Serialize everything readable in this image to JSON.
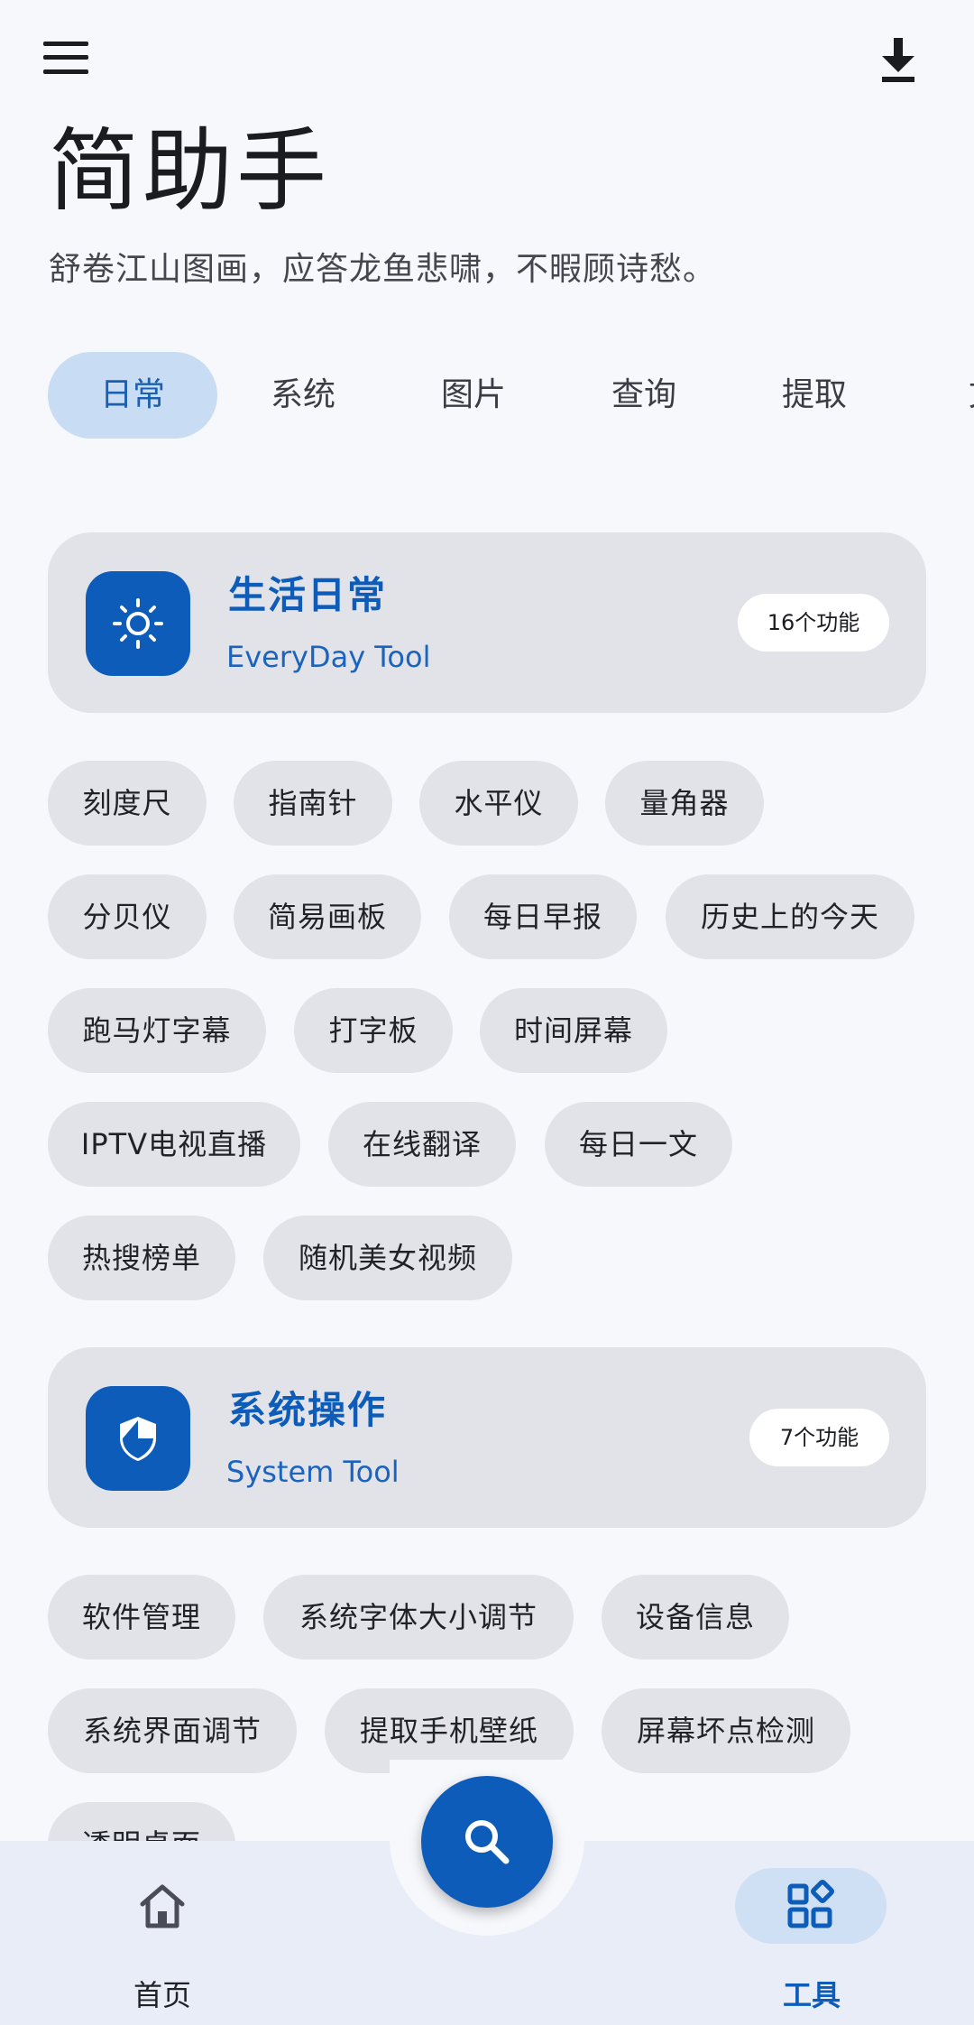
{
  "header": {
    "menu_icon": "menu-icon",
    "download_icon": "download-icon",
    "title": "简助手",
    "subtitle": "舒卷江山图画，应答龙鱼悲啸，不暇顾诗愁。"
  },
  "tabs": [
    {
      "label": "日常",
      "active": true
    },
    {
      "label": "系统",
      "active": false
    },
    {
      "label": "图片",
      "active": false
    },
    {
      "label": "查询",
      "active": false
    },
    {
      "label": "提取",
      "active": false
    },
    {
      "label": "文",
      "active": false
    }
  ],
  "categories": [
    {
      "title": "生活日常",
      "subtitle": "EveryDay Tool",
      "badge": "16个功能",
      "icon": "sun-icon",
      "tools": [
        "刻度尺",
        "指南针",
        "水平仪",
        "量角器",
        "分贝仪",
        "简易画板",
        "每日早报",
        "历史上的今天",
        "跑马灯字幕",
        "打字板",
        "时间屏幕",
        "IPTV电视直播",
        "在线翻译",
        "每日一文",
        "热搜榜单",
        "随机美女视频"
      ]
    },
    {
      "title": "系统操作",
      "subtitle": "System Tool",
      "badge": "7个功能",
      "icon": "shield-icon",
      "tools": [
        "软件管理",
        "系统字体大小调节",
        "设备信息",
        "系统界面调节",
        "提取手机壁纸",
        "屏幕坏点检测",
        "透明桌面"
      ]
    }
  ],
  "fab": {
    "icon": "search-icon"
  },
  "bottom_nav": [
    {
      "label": "首页",
      "icon": "home-icon",
      "active": false
    },
    {
      "label": "工具",
      "icon": "apps-icon",
      "active": true
    }
  ],
  "colors": {
    "accent": "#0e5cb9",
    "tab_active_bg": "#c8dcf3",
    "card_bg": "#e1e3e9",
    "background": "#f7f8fc",
    "nav_bg": "#e8edf7"
  }
}
